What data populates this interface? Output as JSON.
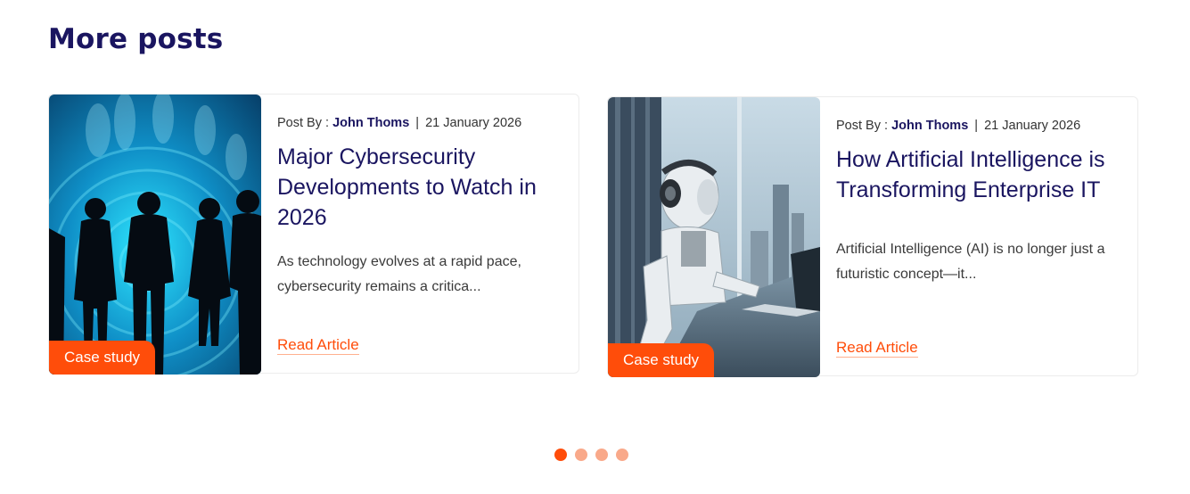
{
  "section": {
    "title": "More posts"
  },
  "posts": [
    {
      "meta_prefix": "Post By :",
      "author": "John Thoms",
      "separator": "|",
      "date": "21 January 2026",
      "title": "Major Cybersecurity Developments to Watch in 2026",
      "excerpt": "As technology evolves at a rapid pace, cybersecurity remains a critica...",
      "badge": "Case study",
      "read_label": "Read Article",
      "image": "silhouettes-cyber-image"
    },
    {
      "meta_prefix": "Post By :",
      "author": "John Thoms",
      "separator": "|",
      "date": "21 January 2026",
      "title": "How Artificial Intelligence is Transforming Enterprise IT",
      "excerpt": "Artificial Intelligence (AI) is no longer just a futuristic concept—it...",
      "badge": "Case study",
      "read_label": "Read Article",
      "image": "robot-laptop-image"
    }
  ],
  "pagination": {
    "total": 4,
    "active": 1
  },
  "colors": {
    "accent": "#ff4d0a",
    "title": "#1a1560",
    "dot_inactive": "#f9a98a"
  }
}
